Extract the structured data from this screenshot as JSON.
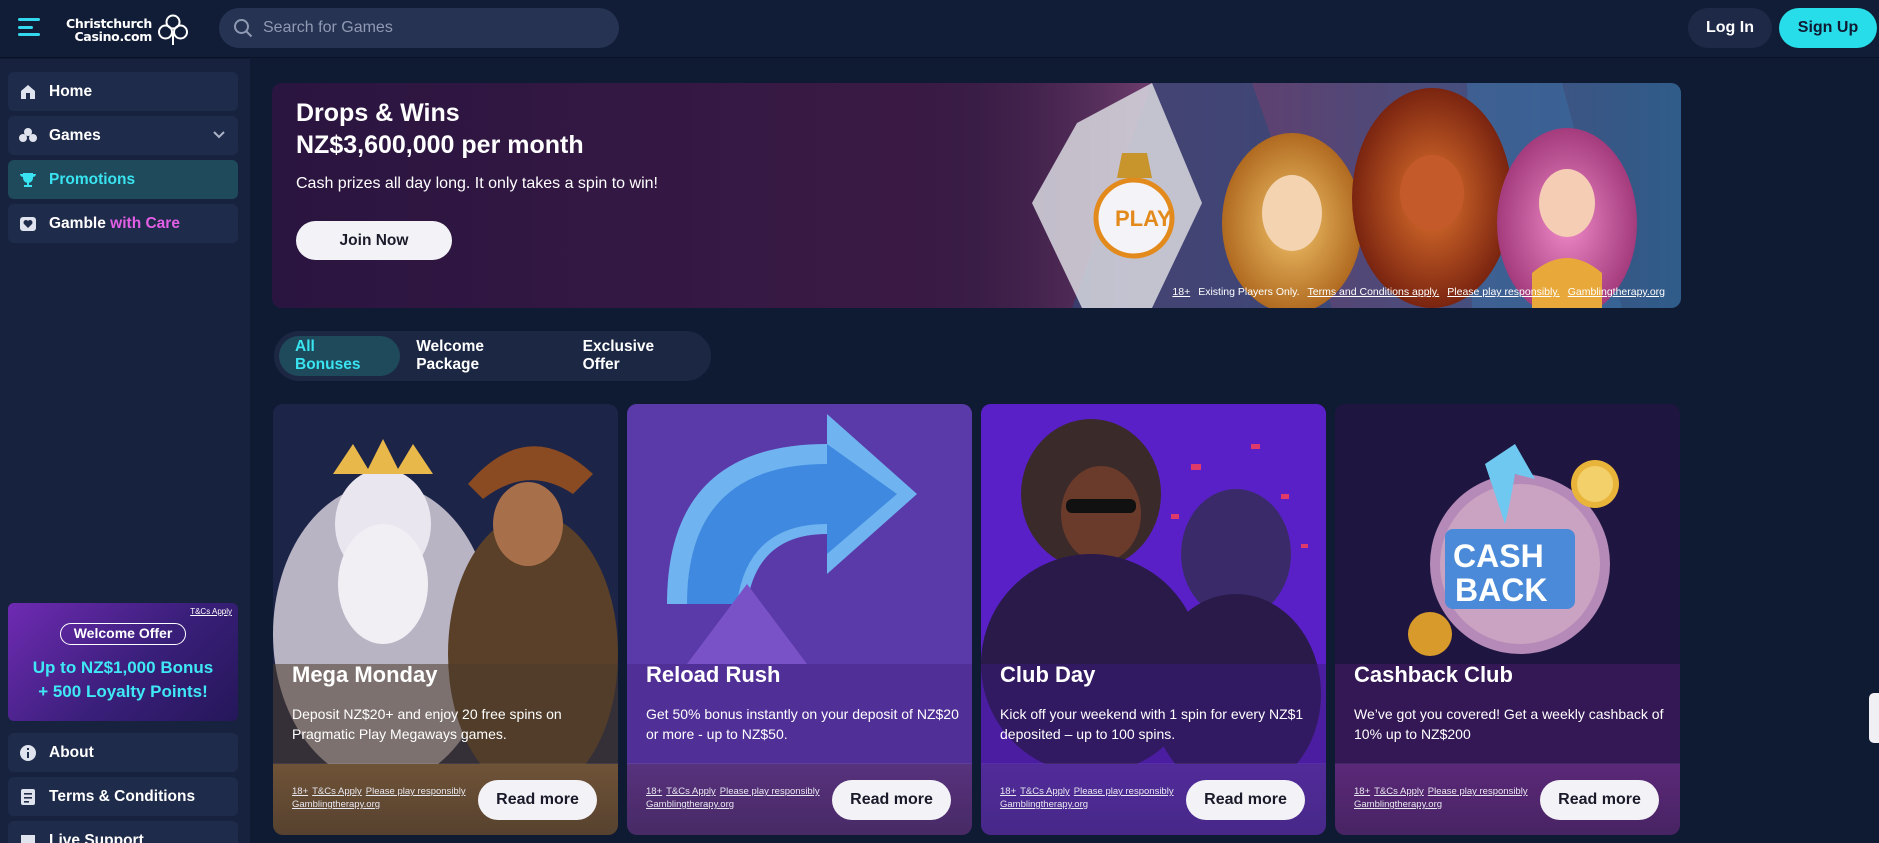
{
  "header": {
    "logo_line1": "Christchurch",
    "logo_line2": "Casino.com",
    "search_placeholder": "Search for Games",
    "login_label": "Log In",
    "signup_label": "Sign Up"
  },
  "sidebar": {
    "items": [
      {
        "label": "Home",
        "icon": "home-icon"
      },
      {
        "label": "Games",
        "icon": "clover-icon"
      },
      {
        "label": "Promotions",
        "icon": "trophy-icon"
      },
      {
        "label": "Gamble",
        "label_accent": "with Care",
        "icon": "heart-shield-icon"
      }
    ],
    "promo": {
      "tc": "T&Cs Apply",
      "pill": "Welcome Offer",
      "line1": "Up to NZ$1,000 Bonus",
      "line2": "+ 500 Loyalty Points!"
    },
    "bottom_items": [
      {
        "label": "About",
        "icon": "info-icon"
      },
      {
        "label": "Terms & Conditions",
        "icon": "document-icon"
      },
      {
        "label": "Live Support",
        "icon": "chat-icon"
      }
    ]
  },
  "hero": {
    "title_line1": "Drops & Wins",
    "title_line2": "NZ$3,600,000 per month",
    "subtitle": "Cash prizes all day long. It only takes a spin to win!",
    "cta": "Join Now",
    "badge": "PLAY",
    "legal": {
      "age": "18+",
      "text": "Existing Players Only.",
      "tc": "Terms and Conditions apply.",
      "responsible": "Please play responsibly.",
      "therapy": "Gamblingtherapy.org"
    }
  },
  "tabs": [
    {
      "label": "All Bonuses",
      "active": true
    },
    {
      "label": "Welcome Package",
      "active": false
    },
    {
      "label": "Exclusive Offer",
      "active": false
    }
  ],
  "cards": [
    {
      "title": "Mega Monday",
      "description": "Deposit NZ$20+ and enjoy 20 free spins on Pragmatic Play Megaways games.",
      "age": "18+",
      "tc": "T&Cs Apply",
      "responsible": "Please play responsibly",
      "therapy": "Gamblingtherapy.org",
      "button": "Read more"
    },
    {
      "title": "Reload Rush",
      "description": "Get 50% bonus instantly on your deposit of NZ$20 or more - up to NZ$50.",
      "age": "18+",
      "tc": "T&Cs Apply",
      "responsible": "Please play responsibly",
      "therapy": "Gamblingtherapy.org",
      "button": "Read more"
    },
    {
      "title": "Club Day",
      "description": "Kick off your weekend with 1 spin for every NZ$1 deposited – up to 100 spins.",
      "age": "18+",
      "tc": "T&Cs Apply",
      "responsible": "Please play responsibly",
      "therapy": "Gamblingtherapy.org",
      "button": "Read more"
    },
    {
      "title": "Cashback Club",
      "description": "We’ve got you covered! Get a weekly cashback of 10% up to NZ$200",
      "age": "18+",
      "tc": "T&Cs Apply",
      "responsible": "Please play responsibly",
      "therapy": "Gamblingtherapy.org",
      "button": "Read more",
      "art_text_1": "CASH",
      "art_text_2": "BACK"
    }
  ],
  "colors": {
    "accent": "#27dde9",
    "bg": "#0f1a33",
    "sidebar": "#17223f",
    "active_tab": "#1e4a5c",
    "pink": "#e25fe6"
  }
}
